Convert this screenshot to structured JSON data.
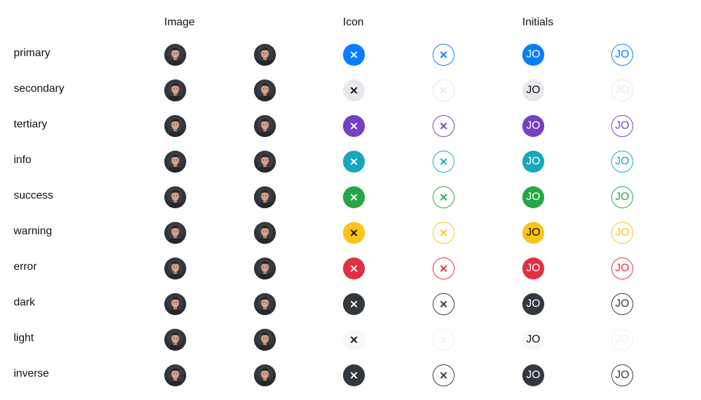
{
  "headers": {
    "image": "Image",
    "icon": "Icon",
    "initials": "Initials"
  },
  "initials_text": "JO",
  "icon_name": "close-icon",
  "rows": [
    {
      "key": "primary",
      "label": "primary",
      "color": "#0a7cff",
      "solid_fg": "#ffffff"
    },
    {
      "key": "secondary",
      "label": "secondary",
      "color": "#e6e8ec",
      "solid_fg": "#111111",
      "outline_stroke": "#e6e8ec"
    },
    {
      "key": "tertiary",
      "label": "tertiary",
      "color": "#7540c2",
      "solid_fg": "#ffffff"
    },
    {
      "key": "info",
      "label": "info",
      "color": "#15a8bb",
      "solid_fg": "#ffffff"
    },
    {
      "key": "success",
      "label": "success",
      "color": "#26a746",
      "solid_fg": "#ffffff"
    },
    {
      "key": "warning",
      "label": "warning",
      "color": "#fcc419",
      "solid_fg": "#111111"
    },
    {
      "key": "error",
      "label": "error",
      "color": "#e03140",
      "solid_fg": "#ffffff"
    },
    {
      "key": "dark",
      "label": "dark",
      "color": "#33383e",
      "solid_fg": "#ffffff"
    },
    {
      "key": "light",
      "label": "light",
      "color": "#f7f8f9",
      "solid_fg": "#111111",
      "outline_stroke": "#eef0f2"
    },
    {
      "key": "inverse",
      "label": "inverse",
      "color": "#33383e",
      "solid_fg": "#ffffff"
    }
  ]
}
